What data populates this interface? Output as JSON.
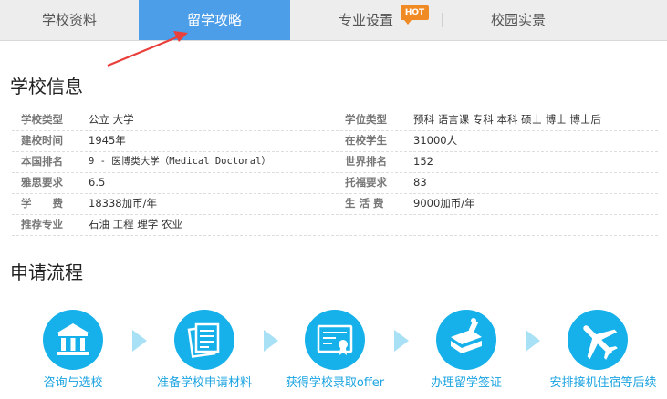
{
  "tabs": [
    {
      "label": "学校资料"
    },
    {
      "label": "留学攻略"
    },
    {
      "label": "专业设置"
    },
    {
      "label": "校园实景"
    }
  ],
  "hot_badge": "HOT",
  "school_info": {
    "title": "学校信息",
    "rows": [
      {
        "l1": "学校类型",
        "v1": "公立 大学",
        "l2": "学位类型",
        "v2": "预科 语言课 专科 本科 硕士 博士 博士后"
      },
      {
        "l1": "建校时间",
        "v1": "1945年",
        "l2": "在校学生",
        "v2": "31000人"
      },
      {
        "l1": "本国排名",
        "v1": "9 - 医博类大学（Medical Doctoral）",
        "l2": "世界排名",
        "v2": "152"
      },
      {
        "l1": "雅思要求",
        "v1": "6.5",
        "l2": "托福要求",
        "v2": "83"
      },
      {
        "l1": "学　　费",
        "v1": "18338加币/年",
        "l2": "生 活 费",
        "v2": "9000加币/年"
      },
      {
        "l1": "推荐专业",
        "v1": "石油 工程 理学 农业",
        "l2": "",
        "v2": ""
      }
    ]
  },
  "process": {
    "title": "申请流程",
    "steps": [
      {
        "label": "咨询与选校",
        "icon": "institution-icon"
      },
      {
        "label": "准备学校申请材料",
        "icon": "documents-icon"
      },
      {
        "label": "获得学校录取offer",
        "icon": "certificate-icon"
      },
      {
        "label": "办理留学签证",
        "icon": "passport-stamp-icon"
      },
      {
        "label": "安排接机住宿等后续",
        "icon": "airplane-icon"
      }
    ]
  },
  "colors": {
    "active_tab": "#4d9ee8",
    "step_circle": "#16b0ea",
    "hot_badge": "#f08a24",
    "pointer_arrow": "#e8413c"
  }
}
